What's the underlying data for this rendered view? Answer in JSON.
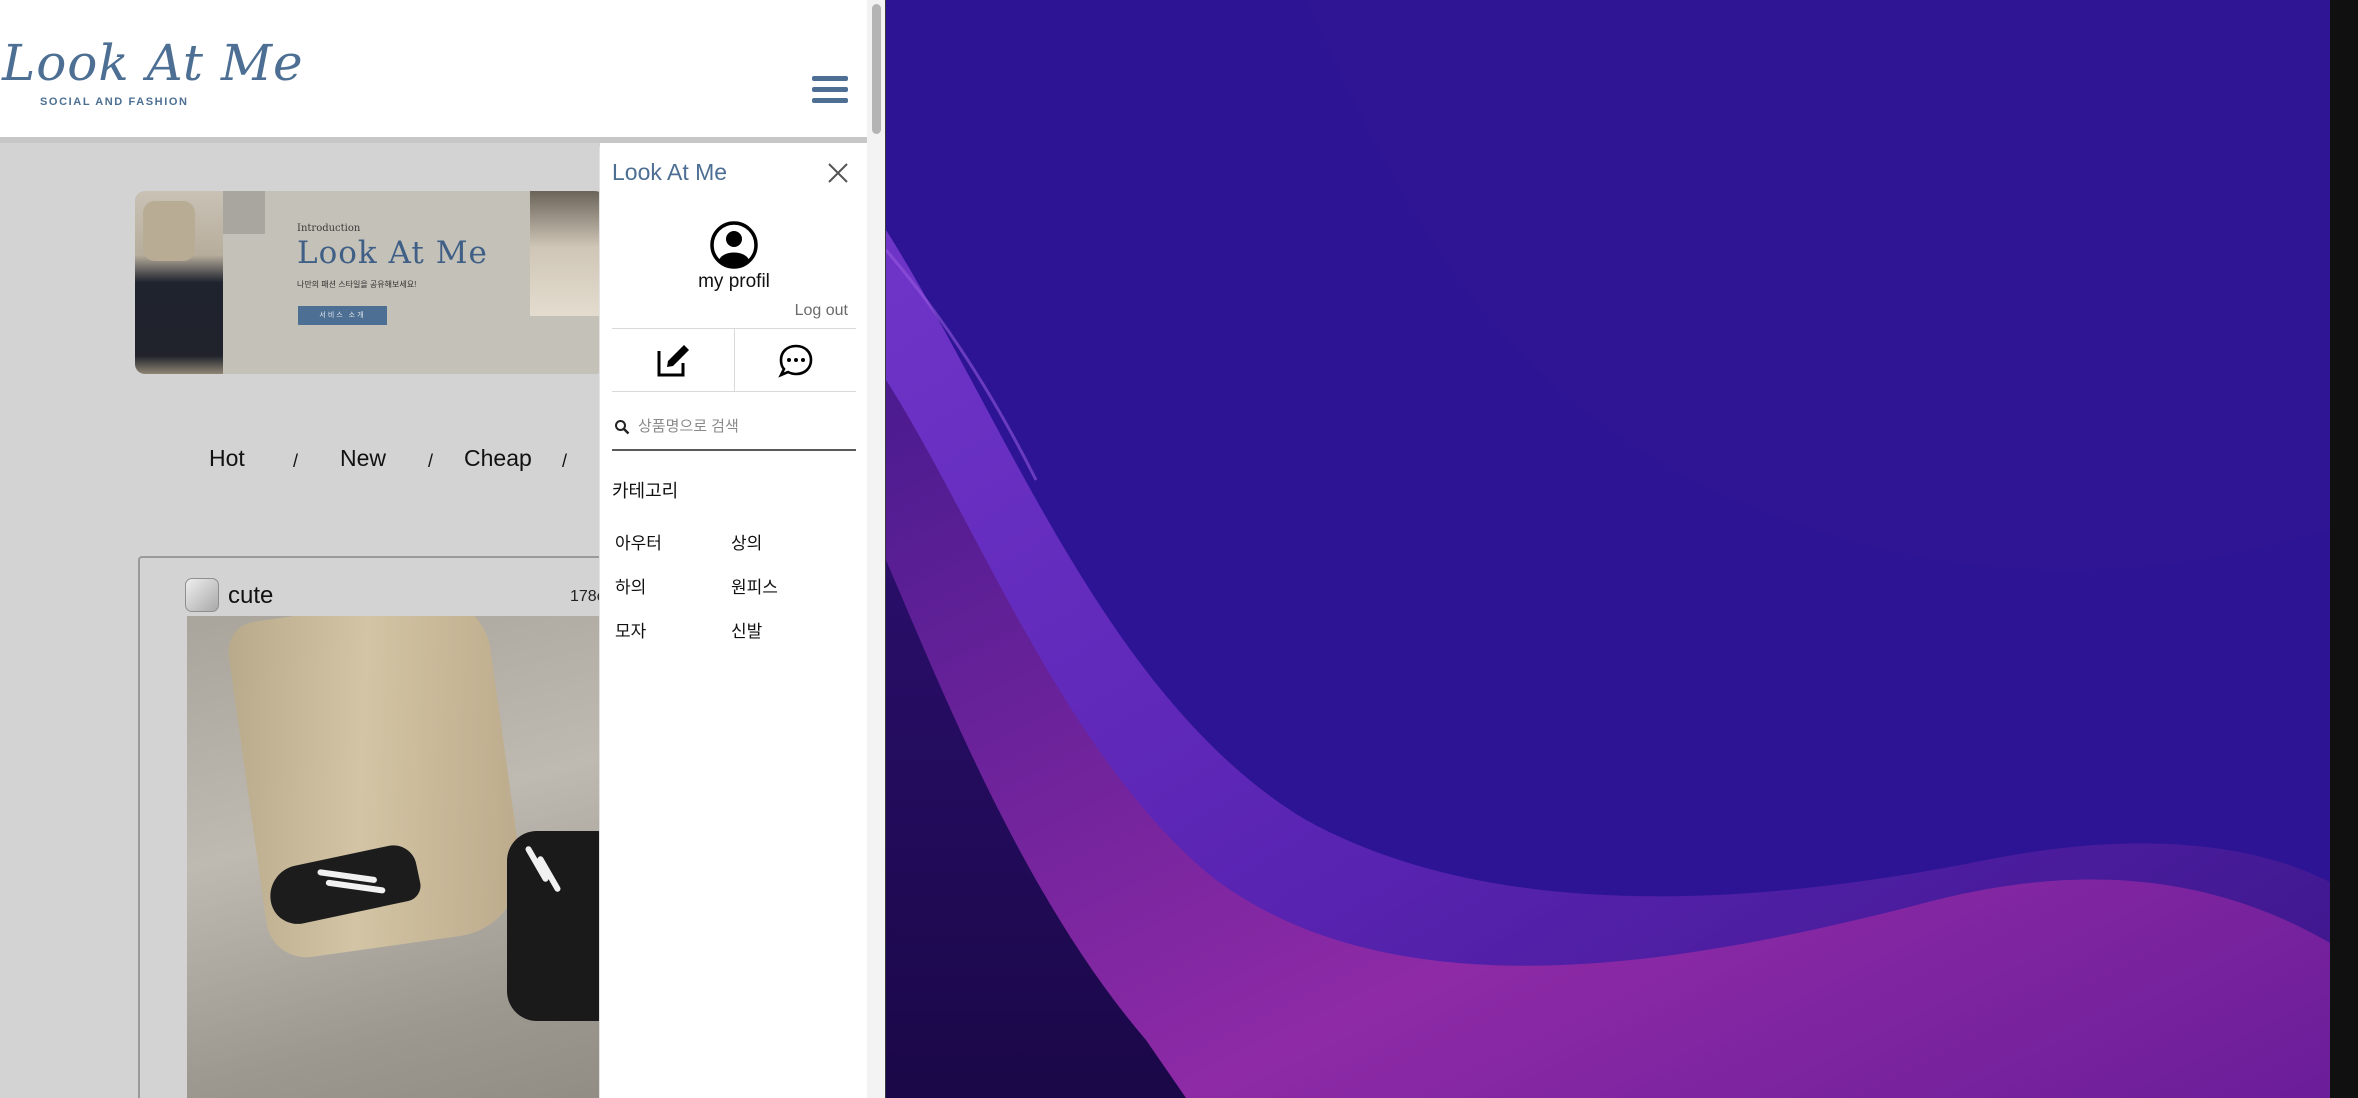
{
  "site": {
    "logo_text": "Look At Me",
    "logo_tagline": "SOCIAL AND FASHION",
    "brand_color": "#4d6f93"
  },
  "banner": {
    "intro": "Introduction",
    "title": "Look At Me",
    "description": "나만의 패션 스타일을 공유해보세요!",
    "button_label": "서비스 소개"
  },
  "filters": [
    "Hot",
    "New",
    "Cheap"
  ],
  "filter_separator": "/",
  "post": {
    "username": "cute",
    "meta": "178c"
  },
  "menu": {
    "title": "Look At Me",
    "profile_label": "my profil",
    "logout_label": "Log out",
    "search_placeholder": "상품명으로 검색",
    "category_title": "카테고리",
    "categories": [
      "아우터",
      "상의",
      "하의",
      "원피스",
      "모자",
      "신발"
    ]
  },
  "icons": {
    "close": "close-icon",
    "profile": "user-circle-icon",
    "edit": "edit-icon",
    "chat": "chat-icon",
    "search": "search-icon",
    "menu": "hamburger-icon"
  },
  "desktop": {
    "wallpaper_colors": [
      "#2e149c",
      "#6a2bc0",
      "#8d2aa8",
      "#1d0c6b"
    ]
  }
}
